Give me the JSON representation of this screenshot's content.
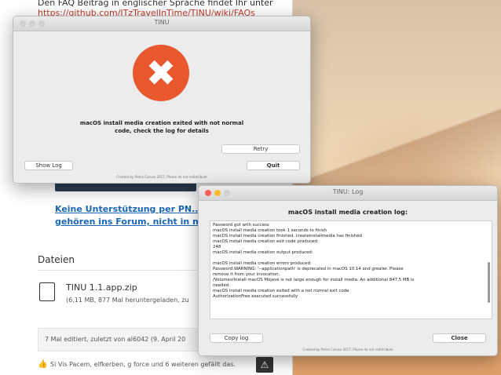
{
  "webpage": {
    "top_text_1": "Den FAQ Beitrag in englischer Sprache findet Ihr unter",
    "top_link": "https://github.com/ITzTravelInTime/TINU/wiki/FAQs",
    "forum_link_1": "Keine Unterstützung per PN... Eur",
    "forum_link_2": "gehören ins Forum, nicht in mein",
    "section_title": "Dateien",
    "file_name": "TINU 1.1.app.zip",
    "file_meta": "(6,11 MB, 877 Mal heruntergeladen, zu",
    "edited_text": "7 Mal editiert, zuletzt von al6042 (9. April 20",
    "likes_text": "Si Vis Pacem, elfkerben, g force und 6 weiteren gefällt das."
  },
  "error_window": {
    "title": "TINU",
    "message_line1": "macOS install media creation exited with not normal",
    "message_line2": "code, check the log for details",
    "retry_label": "Retry",
    "show_log_label": "Show Log",
    "quit_label": "Quit",
    "footer": "Created by Pietro Caruso 2017, Please do not redistribute"
  },
  "log_window": {
    "title": "TINU: Log",
    "heading": "macOS install media creation log:",
    "lines": [
      "Password got with success",
      "macOS install media creation took 1 seconds to finish",
      "macOS install media creation finished, createinstallmedia has finished",
      "macOS install media creation exit code produced:",
      "        248",
      "macOS install media creation output produced:",
      "",
      "macOS install media creation errors produced:",
      "     Password:WARNING: '--applicationpath' is deprecated in macOS 10.14 and greater. Please",
      "remove it from your invocation.",
      "     /Volumes/Install macOS Mojave is not large enough for install media. An additional 847,5 MB is",
      "needed.",
      "macOS install media creation exited with a not normal exit code",
      "AuthorizationFree executed successfully"
    ],
    "copy_log_label": "Copy log",
    "close_label": "Close",
    "footer": "Created by Pietro Caruso 2017, Please do not redistribute"
  },
  "colors": {
    "error_red": "#e9572d",
    "traffic_red": "#fc5f57",
    "traffic_yellow": "#fdbc2e",
    "traffic_green": "#28c840",
    "link_blue": "#1b66b5"
  }
}
